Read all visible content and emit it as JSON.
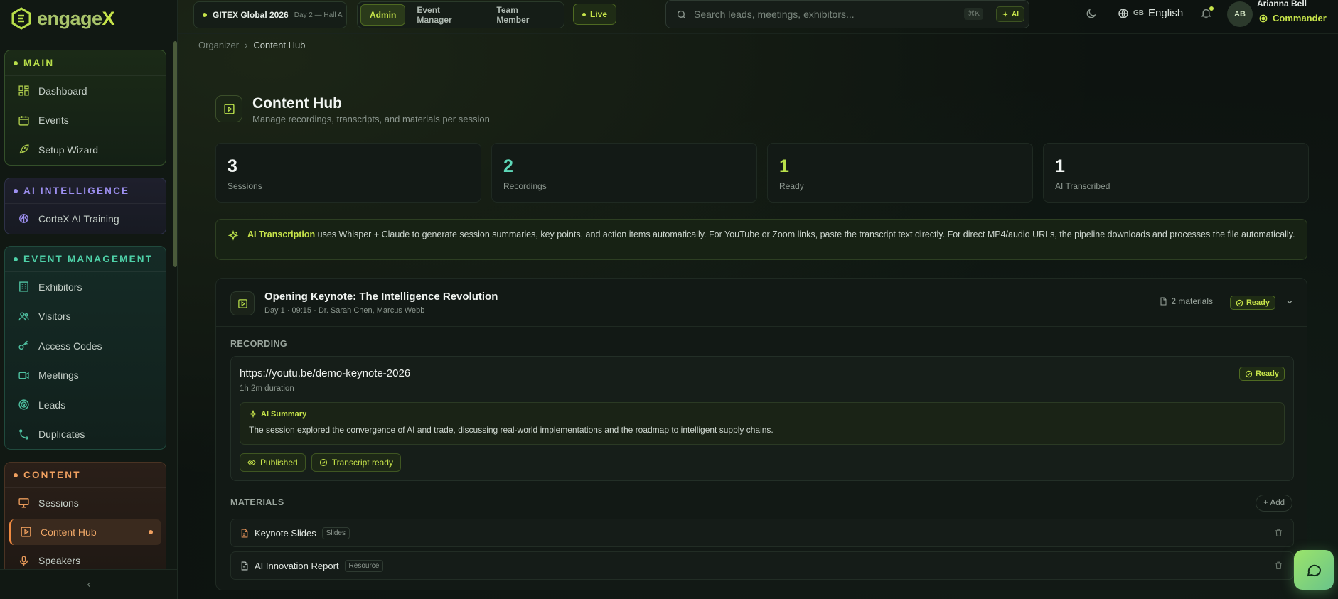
{
  "brand": {
    "name_main": "engage",
    "name_accent": "X"
  },
  "sidebar": {
    "groups": [
      {
        "title": "MAIN",
        "items": [
          {
            "label": "Dashboard",
            "icon": "dashboard-icon"
          },
          {
            "label": "Events",
            "icon": "calendar-icon"
          },
          {
            "label": "Setup Wizard",
            "icon": "rocket-icon"
          }
        ]
      },
      {
        "title": "AI INTELLIGENCE",
        "items": [
          {
            "label": "CorteX AI Training",
            "icon": "brain-icon"
          }
        ]
      },
      {
        "title": "EVENT MANAGEMENT",
        "items": [
          {
            "label": "Exhibitors",
            "icon": "building-icon"
          },
          {
            "label": "Visitors",
            "icon": "users-icon"
          },
          {
            "label": "Access Codes",
            "icon": "key-icon"
          },
          {
            "label": "Meetings",
            "icon": "video-icon"
          },
          {
            "label": "Leads",
            "icon": "target-icon"
          },
          {
            "label": "Duplicates",
            "icon": "merge-icon"
          }
        ]
      },
      {
        "title": "CONTENT",
        "items": [
          {
            "label": "Sessions",
            "icon": "presentation-icon"
          },
          {
            "label": "Content Hub",
            "icon": "play-square-icon",
            "active": true
          },
          {
            "label": "Speakers",
            "icon": "mic-icon"
          }
        ]
      }
    ],
    "collapse_icon": "chevron-left-icon"
  },
  "topbar": {
    "event_name": "GITEX Global 2026",
    "event_sub": "Day 2 — Hall A",
    "roles": [
      "Admin",
      "Event Manager",
      "Team Member"
    ],
    "active_role": "Admin",
    "live_label": "Live",
    "search_placeholder": "Search leads, meetings, exhibitors...",
    "search_shortcut": "⌘K",
    "search_ai_label": "AI",
    "lang_code": "GB",
    "lang_label": "English",
    "avatar_initials": "AB",
    "user_name": "Arianna Bell",
    "user_role": "Commander"
  },
  "breadcrumb": {
    "parent": "Organizer",
    "separator": "›",
    "current": "Content Hub"
  },
  "page": {
    "title": "Content Hub",
    "subtitle": "Manage recordings, transcripts, and materials per session"
  },
  "stats": [
    {
      "value": "3",
      "label": "Sessions",
      "color": "#f2f6f3"
    },
    {
      "value": "2",
      "label": "Recordings",
      "color": "#5ed8b8"
    },
    {
      "value": "1",
      "label": "Ready",
      "color": "#b8e04a"
    },
    {
      "value": "1",
      "label": "AI Transcribed",
      "color": "#f2f6f3"
    }
  ],
  "info": {
    "highlight": "AI Transcription",
    "text": " uses Whisper + Claude to generate session summaries, key points, and action items automatically. For YouTube or Zoom links, paste the transcript text directly. For direct MP4/audio URLs, the pipeline downloads and processes the file automatically."
  },
  "session": {
    "title": "Opening Keynote: The Intelligence Revolution",
    "meta": "Day 1 · 09:15 · Dr. Sarah Chen, Marcus Webb",
    "materials_count": "2 materials",
    "status": "Ready",
    "recording_label": "RECORDING",
    "recording": {
      "url": "https://youtu.be/demo-keynote-2026",
      "duration": "1h 2m duration",
      "status": "Ready",
      "summary_title": "AI Summary",
      "summary_text": "The session explored the convergence of AI and trade, discussing real-world implementations and the roadmap to intelligent supply chains.",
      "tags": [
        "Published",
        "Transcript ready"
      ]
    },
    "materials_label": "MATERIALS",
    "add_label": "+ Add",
    "materials": [
      {
        "name": "Keynote Slides",
        "type": "Slides",
        "icon_color": "#e8945a"
      },
      {
        "name": "AI Innovation Report",
        "type": "Resource",
        "icon_color": "#c8d1cb"
      }
    ]
  },
  "colors": {
    "accent": "#c7e44a",
    "bg": "#0d1310"
  }
}
